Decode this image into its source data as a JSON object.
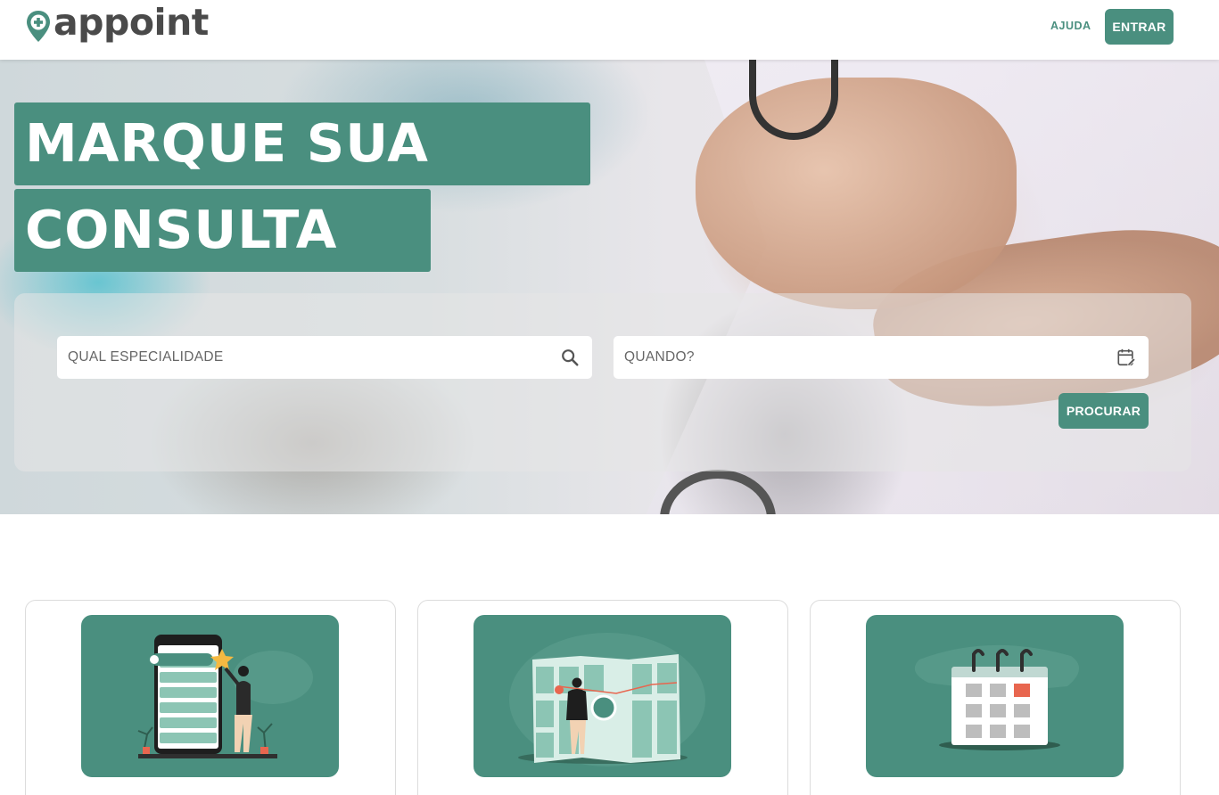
{
  "header": {
    "logo_text": "appoint",
    "nav_help": "AJUDA",
    "login_button": "ENTRAR"
  },
  "hero": {
    "title_line1": "MARQUE SUA",
    "title_line2": "CONSULTA",
    "specialty_placeholder": "QUAL ESPECIALIDADE",
    "when_placeholder": "QUANDO?",
    "search_button": "PROCURAR"
  },
  "icons": {
    "logo": "map-pin-plus-icon",
    "specialty": "search-icon",
    "when": "calendar-edit-icon"
  },
  "cards": [
    {
      "illustration": "phone-reviews-illustration"
    },
    {
      "illustration": "map-location-illustration"
    },
    {
      "illustration": "calendar-illustration"
    }
  ],
  "colors": {
    "brand": "#4a8f7f",
    "logo_text": "#4a4a4a",
    "accent_star": "#f4b942",
    "accent_red": "#e8664f"
  }
}
